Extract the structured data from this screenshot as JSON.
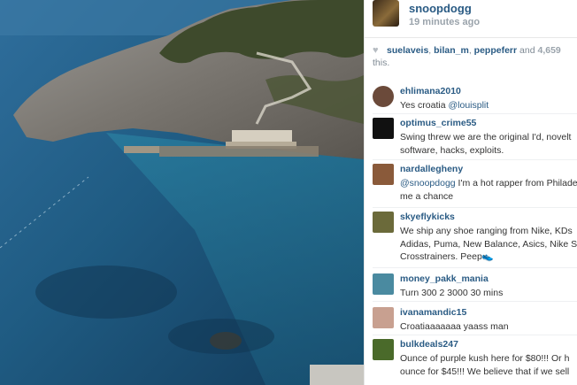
{
  "post": {
    "username": "snoopdogg",
    "timestamp": "19 minutes ago",
    "likes": {
      "users": [
        "suelaveis",
        "bilan_m",
        "peppeferr"
      ],
      "sep1": ",",
      "sep2": ",",
      "and_text": "and",
      "count": "4,659",
      "suffix_partial": "this."
    }
  },
  "comments": [
    {
      "user": "ehlimana2010",
      "text_plain": "Yes croatia ",
      "mention": "@louisplit",
      "line2": "",
      "avatar_color": "#6b4a3a"
    },
    {
      "user": "optimus_crime55",
      "text_plain": "Swing threw we are the original I'd, novelt",
      "mention": "",
      "line2": "software, hacks, exploits.",
      "avatar_color": "#1a1a1a"
    },
    {
      "user": "nardallegheny",
      "text_plain": "",
      "mention": "@snoopdogg",
      "after_mention": " I'm a hot rapper from Philade",
      "line2": "me a chance",
      "avatar_color": "#8a5a3a"
    },
    {
      "user": "skyeflykicks",
      "text_plain": "We ship any shoe ranging from Nike, KDs",
      "mention": "",
      "line2": "Adidas, Puma, New Balance, Asics, Nike S",
      "line3": "Crosstrainers. Peep👟",
      "avatar_color": "#6b6a3a"
    },
    {
      "user": "money_pakk_mania",
      "text_plain": "Turn 300 2 3000 30 mins",
      "mention": "",
      "line2": "",
      "avatar_color": "#4a8aa0"
    },
    {
      "user": "ivanamandic15",
      "text_plain": "Croatiaaaaaaa yaass man",
      "mention": "",
      "line2": "",
      "avatar_color": "#c8a090"
    },
    {
      "user": "bulkdeals247",
      "text_plain": "Ounce of purple kush here for $80!!! Or h",
      "mention": "",
      "line2": "ounce for $45!!! We believe that if we sell",
      "avatar_color": "#4a6a2a"
    }
  ],
  "icons": {
    "heart": "heart-icon"
  }
}
